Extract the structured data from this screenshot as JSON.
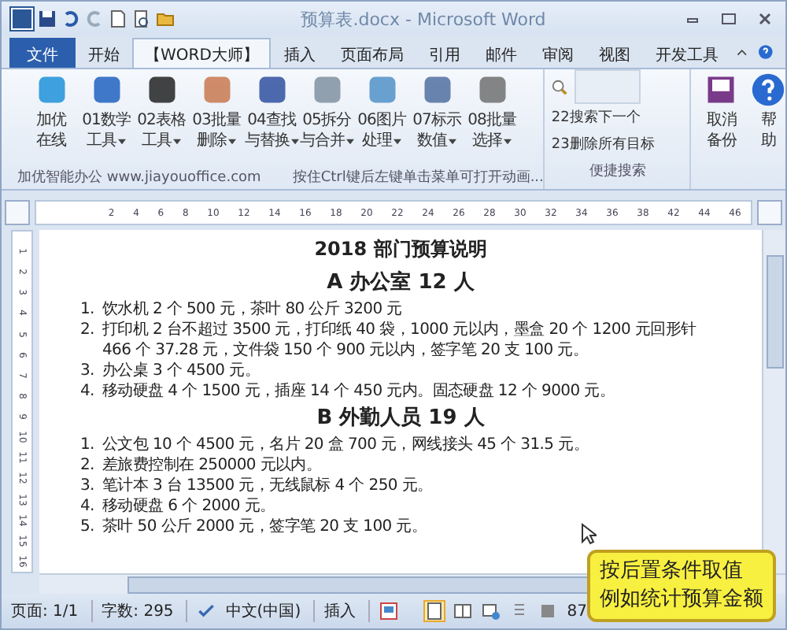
{
  "window": {
    "title": "预算表.docx - Microsoft Word"
  },
  "tabs": [
    {
      "label": "文件",
      "kind": "file",
      "selected": false
    },
    {
      "label": "开始",
      "kind": "tab",
      "selected": false
    },
    {
      "label": "【WORD大师】",
      "kind": "tab",
      "selected": true
    },
    {
      "label": "插入",
      "kind": "tab",
      "selected": false
    },
    {
      "label": "页面布局",
      "kind": "tab",
      "selected": false
    },
    {
      "label": "引用",
      "kind": "tab",
      "selected": false
    },
    {
      "label": "邮件",
      "kind": "tab",
      "selected": false
    },
    {
      "label": "审阅",
      "kind": "tab",
      "selected": false
    },
    {
      "label": "视图",
      "kind": "tab",
      "selected": false
    },
    {
      "label": "开发工具",
      "kind": "tab",
      "selected": false
    }
  ],
  "ribbon": {
    "tools": [
      {
        "line1": "加优",
        "line2": "在线",
        "dropdown": false
      },
      {
        "line1": "01数学",
        "line2": "工具",
        "dropdown": true
      },
      {
        "line1": "02表格",
        "line2": "工具",
        "dropdown": true
      },
      {
        "line1": "03批量",
        "line2": "删除",
        "dropdown": true
      },
      {
        "line1": "04查找",
        "line2": "与替换",
        "dropdown": true
      },
      {
        "line1": "05拆分",
        "line2": "与合并",
        "dropdown": true
      },
      {
        "line1": "06图片",
        "line2": "处理",
        "dropdown": true
      },
      {
        "line1": "07标示",
        "line2": "数值",
        "dropdown": true
      },
      {
        "line1": "08批量",
        "line2": "选择",
        "dropdown": true
      }
    ],
    "footer_left": "加优智能办公  www.jiayouoffice.com",
    "footer_hint": "按住Ctrl键后左键单击菜单可打开动画...",
    "search_items": [
      "22搜索下一个",
      "23删除所有目标"
    ],
    "search_group": "便捷搜索",
    "side_tools": [
      {
        "line1": "取消",
        "line2": "备份"
      },
      {
        "line1": "帮",
        "line2": "助"
      }
    ]
  },
  "ruler_numbers": [
    "2",
    "4",
    "6",
    "8",
    "10",
    "12",
    "14",
    "16",
    "18",
    "20",
    "22",
    "24",
    "26",
    "28",
    "30",
    "32",
    "34",
    "36",
    "38",
    "42",
    "44",
    "46"
  ],
  "vertical_ruler_numbers": [
    "1",
    "2",
    "3",
    "4",
    "5",
    "6",
    "7",
    "8",
    "9",
    "10",
    "11",
    "12",
    "13",
    "14",
    "15",
    "16"
  ],
  "document": {
    "title": "2018 部门预算说明",
    "sections": [
      {
        "heading": "A 办公室 12 人",
        "items": [
          {
            "num": "1.",
            "text": "饮水机 2 个 500 元，茶叶 80 公斤 3200 元"
          },
          {
            "num": "2.",
            "text": "打印机 2 台不超过 3500 元，打印纸 40 袋，1000 元以内，墨盒 20 个 1200 元回形针 466 个 37.28 元，文件袋 150 个 900 元以内，签字笔 20 支 100 元。"
          },
          {
            "num": "3.",
            "text": "办公桌 3 个 4500 元。"
          },
          {
            "num": "4.",
            "text": "移动硬盘 4 个 1500 元，插座 14 个 450 元内。固态硬盘 12 个 9000 元。"
          }
        ]
      },
      {
        "heading": "B 外勤人员 19 人",
        "items": [
          {
            "num": "1.",
            "text": "公文包 10 个 4500 元，名片 20 盒 700 元，网线接头 45 个 31.5 元。"
          },
          {
            "num": "2.",
            "text": "差旅费控制在 250000 元以内。"
          },
          {
            "num": "3.",
            "text": "笔计本 3 台 13500 元，无线鼠标 4 个 250 元。"
          },
          {
            "num": "4.",
            "text": "移动硬盘 6 个 2000 元。"
          },
          {
            "num": "5.",
            "text": "茶叶 50 公斤 2000 元，签字笔 20 支 100 元。"
          }
        ]
      }
    ]
  },
  "status_bar": {
    "page": "页面: 1/1",
    "words": "字数: 295",
    "language": "中文(中国)",
    "mode": "插入",
    "zoom": "87"
  },
  "callout": {
    "lines": [
      "按后置条件取值",
      "例如统计预算金额"
    ]
  }
}
